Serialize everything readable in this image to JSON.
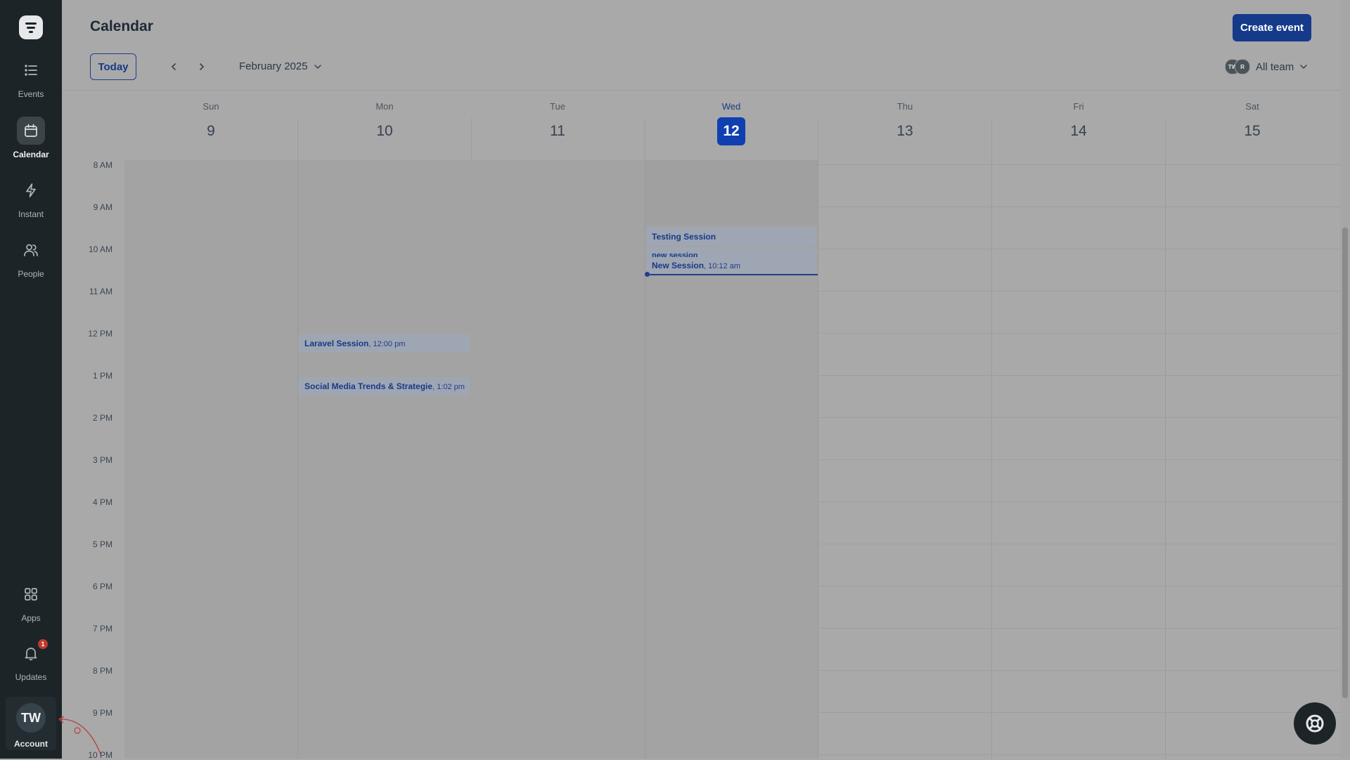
{
  "sidebar": {
    "items": [
      {
        "label": "Events",
        "icon": "list-icon"
      },
      {
        "label": "Calendar",
        "icon": "calendar-icon"
      },
      {
        "label": "Instant",
        "icon": "bolt-icon"
      },
      {
        "label": "People",
        "icon": "people-icon"
      },
      {
        "label": "Apps",
        "icon": "grid-icon"
      },
      {
        "label": "Updates",
        "icon": "bell-icon"
      }
    ],
    "updates_badge": "1",
    "account": {
      "initials": "TW",
      "label": "Account"
    }
  },
  "header": {
    "title": "Calendar",
    "create_label": "Create event",
    "today_label": "Today",
    "month_label": "February 2025",
    "team_label": "All team",
    "team_avatars": [
      "TW",
      "R"
    ]
  },
  "week": {
    "days": [
      {
        "name": "Sun",
        "num": "9"
      },
      {
        "name": "Mon",
        "num": "10"
      },
      {
        "name": "Tue",
        "num": "11"
      },
      {
        "name": "Wed",
        "num": "12"
      },
      {
        "name": "Thu",
        "num": "13"
      },
      {
        "name": "Fri",
        "num": "14"
      },
      {
        "name": "Sat",
        "num": "15"
      }
    ]
  },
  "hours": [
    "8 AM",
    "9 AM",
    "10 AM",
    "11 AM",
    "12 PM",
    "1 PM",
    "2 PM",
    "3 PM",
    "4 PM",
    "5 PM",
    "6 PM",
    "7 PM",
    "8 PM",
    "9 PM",
    "10 PM"
  ],
  "events": [
    {
      "title": "Testing Session",
      "time": ""
    },
    {
      "title": "new session",
      "time": ""
    },
    {
      "title": "New Session",
      "time": "10:12 am"
    },
    {
      "title": "Laravel Session",
      "time": "12:00 pm"
    },
    {
      "title": "Social Media Trends & Strategie",
      "time": "1:02 pm"
    }
  ],
  "colors": {
    "accent": "#153a8a",
    "sidebar": "#1c2428",
    "today": "#0f3fb0"
  }
}
